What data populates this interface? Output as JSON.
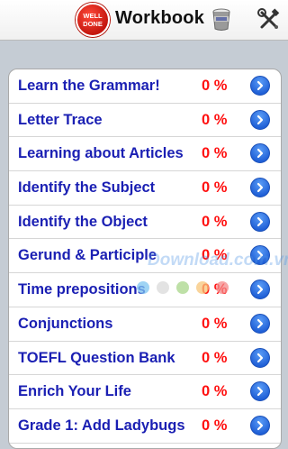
{
  "header": {
    "logo_text": "WELL DONE",
    "title": "Workbook",
    "icons": [
      "well-done-logo-icon",
      "cup-icon",
      "tools-icon"
    ]
  },
  "workbook": {
    "items": [
      {
        "label": "Learn the Grammar!",
        "percent": "0 %"
      },
      {
        "label": "Letter Trace",
        "percent": "0 %"
      },
      {
        "label": "Learning about Articles",
        "percent": "0 %"
      },
      {
        "label": "Identify the Subject",
        "percent": "0 %"
      },
      {
        "label": "Identify the Object",
        "percent": "0 %"
      },
      {
        "label": "Gerund & Participle",
        "percent": "0 %"
      },
      {
        "label": "Time prepositions",
        "percent": "0 %"
      },
      {
        "label": "Conjunctions",
        "percent": "0 %"
      },
      {
        "label": "TOEFL Question Bank",
        "percent": "0 %"
      },
      {
        "label": "Enrich Your Life",
        "percent": "0 %"
      },
      {
        "label": "Grade 1: Add Ladybugs",
        "percent": "0 %"
      }
    ]
  },
  "watermark": {
    "text": "Download.com.vn",
    "dot_colors": [
      "#7fc6f0",
      "#d9d9d9",
      "#a8d58a",
      "#f7c67a",
      "#f48a8a"
    ]
  },
  "colors": {
    "item_label": "#1a1fb3",
    "percent": "#ff1010",
    "disclosure": "#1f5fd6",
    "background": "#c5ccd4"
  }
}
